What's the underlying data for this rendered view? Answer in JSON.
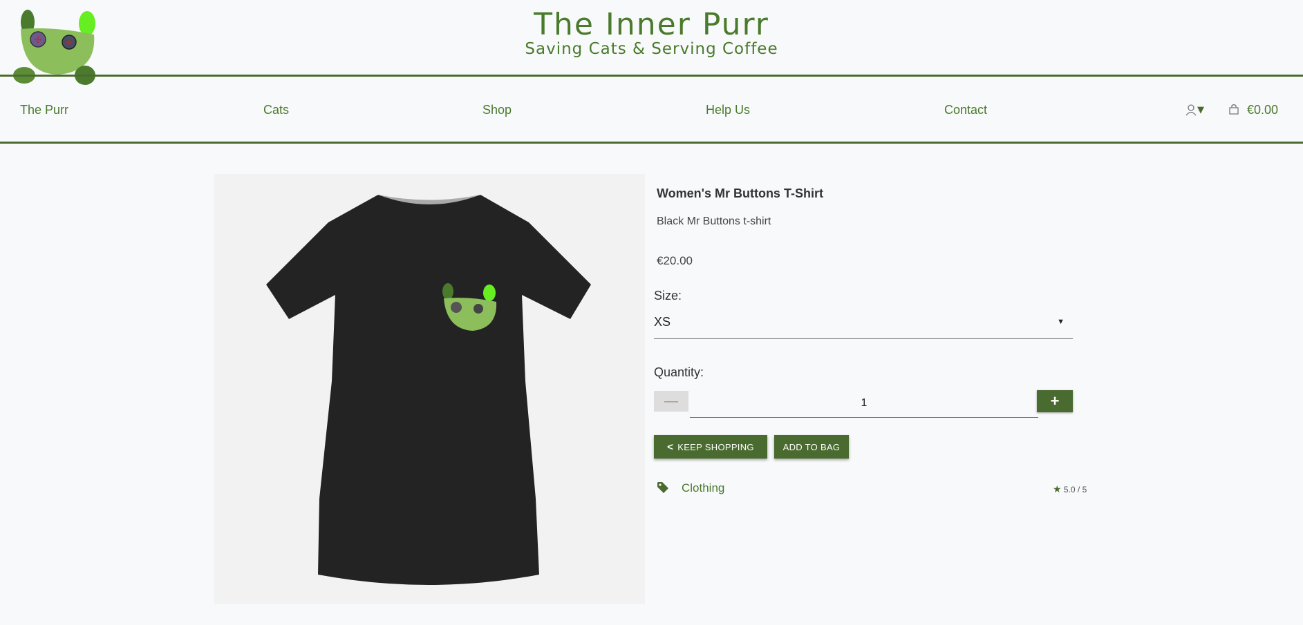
{
  "header": {
    "brand_title": "The Inner Purr",
    "brand_subtitle": "Saving Cats & Serving Coffee"
  },
  "nav": {
    "items": [
      {
        "label": "The Purr"
      },
      {
        "label": "Cats"
      },
      {
        "label": "Shop"
      },
      {
        "label": "Help Us"
      },
      {
        "label": "Contact"
      }
    ],
    "bag_total": "€0.00"
  },
  "product": {
    "title": "Women's Mr Buttons T-Shirt",
    "description": "Black Mr Buttons t-shirt",
    "price": "€20.00",
    "size_label": "Size:",
    "size_value": "XS",
    "quantity_label": "Quantity:",
    "quantity_value": "1",
    "keep_shopping_label": "KEEP SHOPPING",
    "add_to_bag_label": "ADD TO BAG",
    "category": "Clothing",
    "rating": "5.0 / 5"
  },
  "colors": {
    "brand_green": "#4a6b2f",
    "text_green": "#4a7a2c",
    "background": "#f8f9fa"
  }
}
